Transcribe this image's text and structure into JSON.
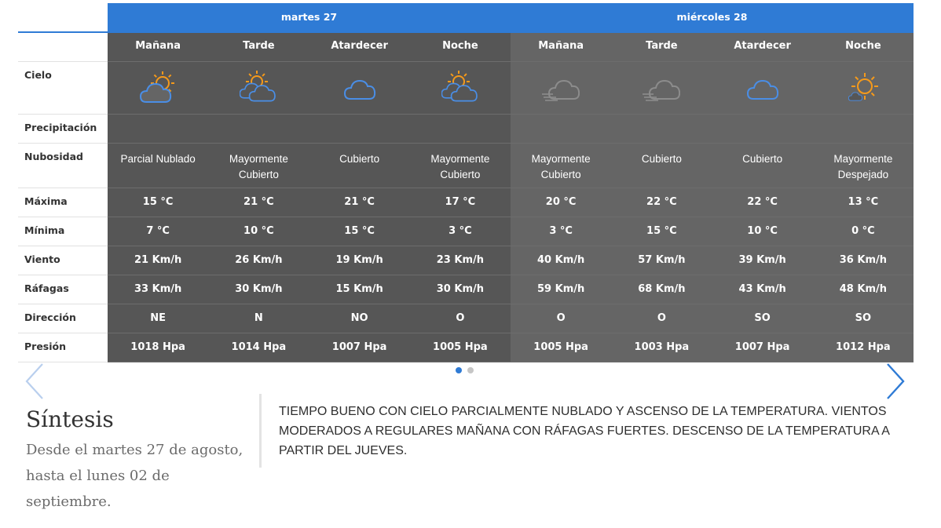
{
  "days": [
    {
      "label": "martes 27"
    },
    {
      "label": "miércoles 28"
    }
  ],
  "periods": [
    {
      "label": "Mañana",
      "icon": "sun-behind-cloud-icon",
      "nubosidad": "Parcial Nublado",
      "max": "15 °C",
      "min": "7 °C",
      "viento": "21 Km/h",
      "rafagas": "33 Km/h",
      "direccion": "NE",
      "presion": "1018 Hpa"
    },
    {
      "label": "Tarde",
      "icon": "sun-behind-clouds-icon",
      "nubosidad": "Mayormente Cubierto",
      "max": "21 °C",
      "min": "10 °C",
      "viento": "26 Km/h",
      "rafagas": "30 Km/h",
      "direccion": "N",
      "presion": "1014 Hpa"
    },
    {
      "label": "Atardecer",
      "icon": "cloud-icon",
      "nubosidad": "Cubierto",
      "max": "21 °C",
      "min": "15 °C",
      "viento": "19 Km/h",
      "rafagas": "15 Km/h",
      "direccion": "NO",
      "presion": "1007 Hpa"
    },
    {
      "label": "Noche",
      "icon": "sun-behind-clouds-icon",
      "nubosidad": "Mayormente Cubierto",
      "max": "17 °C",
      "min": "3 °C",
      "viento": "23 Km/h",
      "rafagas": "30 Km/h",
      "direccion": "O",
      "presion": "1005 Hpa"
    },
    {
      "label": "Mañana",
      "icon": "cloud-wind-icon",
      "nubosidad": "Mayormente Cubierto",
      "max": "20 °C",
      "min": "3 °C",
      "viento": "40 Km/h",
      "rafagas": "59 Km/h",
      "direccion": "O",
      "presion": "1005 Hpa"
    },
    {
      "label": "Tarde",
      "icon": "cloud-wind-icon",
      "nubosidad": "Cubierto",
      "max": "22 °C",
      "min": "15 °C",
      "viento": "57 Km/h",
      "rafagas": "68 Km/h",
      "direccion": "O",
      "presion": "1003 Hpa"
    },
    {
      "label": "Atardecer",
      "icon": "cloud-icon",
      "nubosidad": "Cubierto",
      "max": "22 °C",
      "min": "10 °C",
      "viento": "39 Km/h",
      "rafagas": "43 Km/h",
      "direccion": "SO",
      "presion": "1007 Hpa"
    },
    {
      "label": "Noche",
      "icon": "sun-small-cloud-icon",
      "nubosidad": "Mayormente Despejado",
      "max": "13 °C",
      "min": "0 °C",
      "viento": "36 Km/h",
      "rafagas": "48 Km/h",
      "direccion": "SO",
      "presion": "1012 Hpa"
    }
  ],
  "row_labels": {
    "cielo": "Cielo",
    "precipitacion": "Precipitación",
    "nubosidad": "Nubosidad",
    "max": "Máxima",
    "min": "Mínima",
    "viento": "Viento",
    "rafagas": "Ráfagas",
    "direccion": "Dirección",
    "presion": "Presión"
  },
  "carousel": {
    "pages": 2,
    "active": 0
  },
  "synthesis": {
    "title": "Síntesis",
    "range": "Desde el martes 27 de agosto, hasta el lunes 02 de septiembre.",
    "text": "TIEMPO BUENO CON CIELO PARCIALMENTE NUBLADO Y ASCENSO DE LA TEMPERATURA. VIENTOS MODERADOS A REGULARES MAÑANA CON RÁFAGAS FUERTES. DESCENSO DE LA TEMPERATURA A PARTIR DEL JUEVES."
  },
  "colors": {
    "accent": "#2f7bd5",
    "cell_dark": "#565656",
    "cell_light": "#656565",
    "sun": "#f59a1b",
    "cloud_blue": "#4a8ee6",
    "cloud_gray": "#8c8c8c"
  }
}
